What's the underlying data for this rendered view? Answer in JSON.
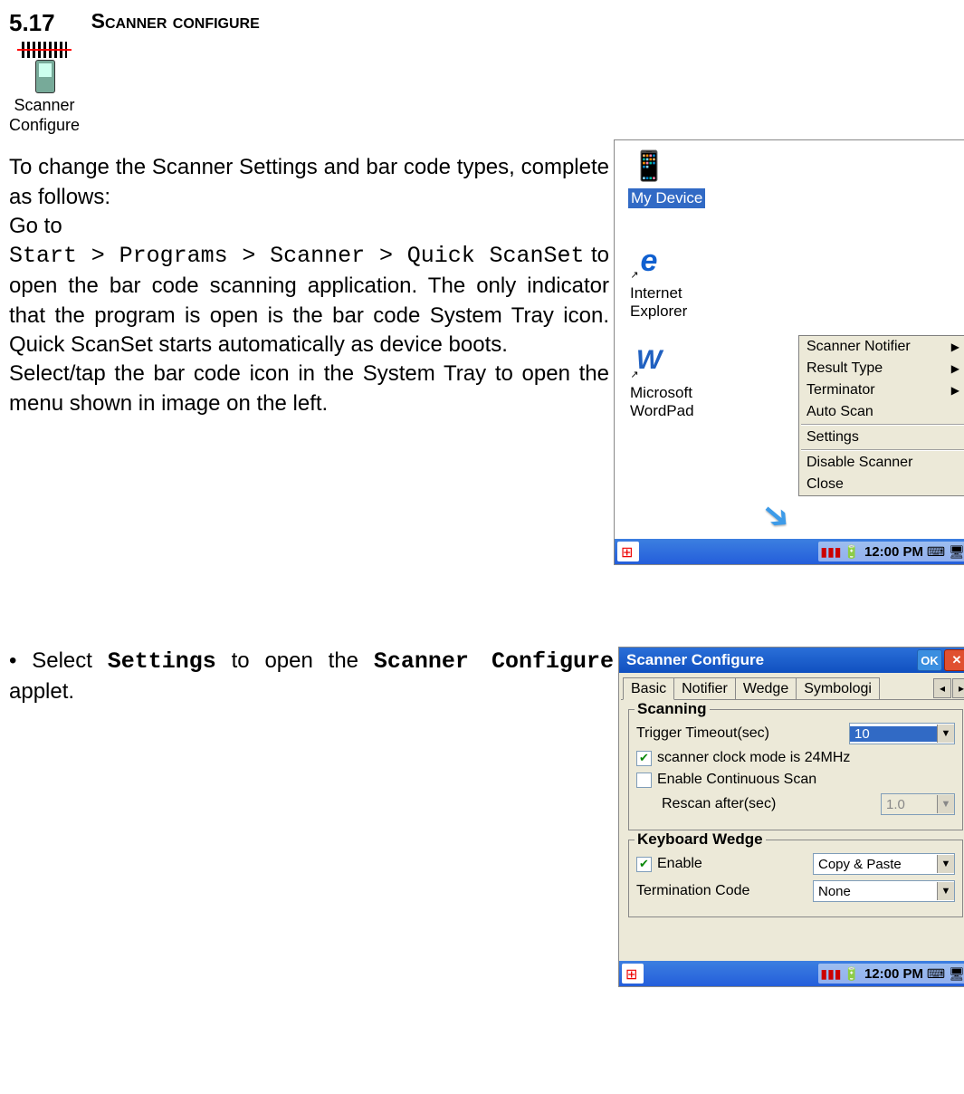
{
  "section": {
    "number": "5.17",
    "title": "Scanner configure"
  },
  "icon_block": {
    "label_line1": "Scanner",
    "label_line2": "Configure"
  },
  "paragraph1": {
    "intro1": "To change the Scanner Settings and bar code types, complete as follows:",
    "goto": "Go to",
    "path": "Start > Programs > Scanner > Quick ScanSet",
    "body": "to open the bar code scanning application. The only indicator that the program is open is the bar code System Tray icon. Quick ScanSet starts automatically as device boots.",
    "body2": "Select/tap the bar code icon in the System Tray to open the menu shown in image on the left."
  },
  "paragraph2": {
    "bullet": "•",
    "text1": "Select",
    "bold1": "Settings",
    "text2": "to open the",
    "bold2": "Scanner Configure",
    "text3": "applet."
  },
  "screenshot1": {
    "desktop": {
      "my_device": "My Device",
      "internet_explorer": "Internet Explorer",
      "wordpad": "Microsoft WordPad"
    },
    "menu": {
      "scanner_notifier": "Scanner Notifier",
      "result_type": "Result Type",
      "terminator": "Terminator",
      "auto_scan": "Auto Scan",
      "settings": "Settings",
      "disable_scanner": "Disable Scanner",
      "close": "Close"
    },
    "taskbar": {
      "time": "12:00 PM"
    }
  },
  "screenshot2": {
    "title": "Scanner Configure",
    "ok": "OK",
    "tabs": {
      "basic": "Basic",
      "notifier": "Notifier",
      "wedge": "Wedge",
      "symbologi": "Symbologi"
    },
    "scanning": {
      "legend": "Scanning",
      "trigger_timeout_label": "Trigger Timeout(sec)",
      "trigger_timeout_value": "10",
      "clock_mode": "scanner clock mode is 24MHz",
      "enable_continuous": "Enable Continuous Scan",
      "rescan_after_label": "Rescan after(sec)",
      "rescan_after_value": "1.0"
    },
    "keyboard_wedge": {
      "legend": "Keyboard Wedge",
      "enable": "Enable",
      "mode_value": "Copy & Paste",
      "termination_label": "Termination Code",
      "termination_value": "None"
    },
    "taskbar": {
      "time": "12:00 PM"
    }
  }
}
